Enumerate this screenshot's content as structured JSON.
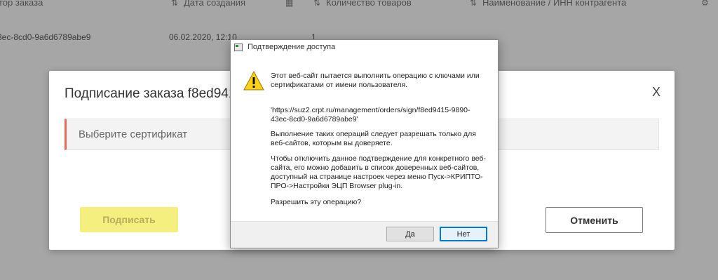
{
  "table": {
    "headers": [
      "тор заказа",
      "Дата создания",
      "Количество товаров",
      "Наименование / ИНН контрагента"
    ],
    "row": {
      "order_id": "3ec-8cd0-9a6d6789abe9",
      "date": "06.02.2020, 12:10",
      "count": "1"
    }
  },
  "sign_modal": {
    "title": "Подписание заказа f8ed9415",
    "close_label": "X",
    "certificate_placeholder": "Выберите сертификат",
    "sign_label": "Подписать",
    "cancel_label": "Отменить",
    "colors": {
      "sign_button": "#f5ef7f",
      "select_accent": "#e86a5e"
    }
  },
  "dialog": {
    "title": "Подтверждение доступа",
    "warning_icon": "warning-triangle-icon",
    "message_1": "Этот веб-сайт пытается выполнить операцию с ключами или сертификатами от имени пользователя.",
    "url": "'https://suz2.crpt.ru/management/orders/sign/f8ed9415-9890-43ec-8cd0-9a6d6789abe9'",
    "message_2": "Выполнение таких операций следует разрешать только для веб-сайтов, которым вы доверяете.",
    "message_3": "Чтобы отключить данное подтверждение для конкретного веб-сайта, его можно добавить в список доверенных веб-сайтов, доступный на странице настроек через меню Пуск->КРИПТО-ПРО->Настройки ЭЦП Browser plug-in.",
    "question": "Разрешить эту операцию?",
    "yes_label": "Да",
    "no_label": "Нет"
  }
}
